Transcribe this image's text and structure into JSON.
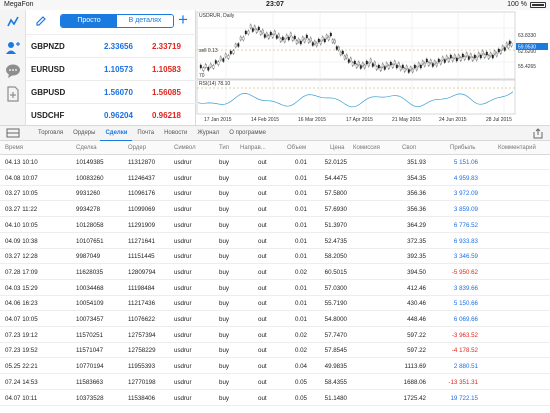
{
  "status_bar": {
    "carrier": "MegaFon",
    "time": "23:07",
    "battery": "100 %"
  },
  "quotes_panel": {
    "segments": [
      "Просто",
      "В деталях"
    ],
    "active_segment": "Просто",
    "rows": [
      {
        "symbol": "GBPNZD",
        "bid": "2.33656",
        "ask": "2.33719"
      },
      {
        "symbol": "EURUSD",
        "bid": "1.10573",
        "ask": "1.10583"
      },
      {
        "symbol": "GBPUSD",
        "bid": "1.56070",
        "ask": "1.56085"
      },
      {
        "symbol": "USDCHF",
        "bid": "0.96204",
        "ask": "0.96218"
      }
    ]
  },
  "chart": {
    "title": "USDRUR, Daily",
    "sell_label": "sell 0.13",
    "indicator_label": "RSI(14) 78.10",
    "level_label": "70",
    "price_labels": [
      "63.8330",
      "62.6200",
      "59.9530",
      "55.4265"
    ],
    "current_price": "59.9530",
    "x_labels": [
      "17 Jan 2015",
      "14 Feb 2015",
      "16 Mar 2015",
      "17 Apr 2015",
      "21 May 2015",
      "24 Jun 2015",
      "28 Jul 2015"
    ],
    "accent": "#1a7ae0"
  },
  "tabs": {
    "items": [
      "Торговля",
      "Ордеры",
      "Сделки",
      "Почта",
      "Новости",
      "Журнал",
      "О программе"
    ],
    "active": "Сделки"
  },
  "table": {
    "columns": [
      "Время",
      "Сделка",
      "Ордер",
      "Символ",
      "Тип",
      "Направ...",
      "Объем",
      "Цена",
      "Комиссия",
      "Своп",
      "Прибыль",
      "Комментарий"
    ],
    "rows": [
      [
        "04.13 10:10",
        "10149385",
        "11312870",
        "usdrur",
        "buy",
        "out",
        "0.01",
        "52.0125",
        "",
        "351.93",
        "5 151.06"
      ],
      [
        "04.08 10:07",
        "10083260",
        "11246437",
        "usdrur",
        "buy",
        "out",
        "0.01",
        "54.4475",
        "",
        "354.35",
        "4 959.83"
      ],
      [
        "03.27 10:05",
        "9931260",
        "11096176",
        "usdrur",
        "buy",
        "out",
        "0.01",
        "57.5800",
        "",
        "356.36",
        "3 972.09"
      ],
      [
        "03.27 11:22",
        "9934278",
        "11099069",
        "usdrur",
        "buy",
        "out",
        "0.01",
        "57.6930",
        "",
        "356.36",
        "3 859.09"
      ],
      [
        "04.10 10:05",
        "10128058",
        "11291909",
        "usdrur",
        "buy",
        "out",
        "0.01",
        "51.3970",
        "",
        "364.29",
        "6 776.52"
      ],
      [
        "04.09 10:38",
        "10107651",
        "11271641",
        "usdrur",
        "buy",
        "out",
        "0.01",
        "52.4735",
        "",
        "372.35",
        "6 933.83"
      ],
      [
        "03.27 12:28",
        "9987049",
        "11151445",
        "usdrur",
        "buy",
        "out",
        "0.01",
        "58.2050",
        "",
        "392.35",
        "3 346.59"
      ],
      [
        "07.28 17:09",
        "11628035",
        "12809794",
        "usdrur",
        "buy",
        "out",
        "0.02",
        "60.5015",
        "",
        "394.50",
        "-5 950.62"
      ],
      [
        "04.03 15:29",
        "10034468",
        "11198484",
        "usdrur",
        "buy",
        "out",
        "0.01",
        "57.0300",
        "",
        "412.46",
        "3 839.66"
      ],
      [
        "04.06 16:23",
        "10054109",
        "11217436",
        "usdrur",
        "buy",
        "out",
        "0.01",
        "55.7190",
        "",
        "430.46",
        "5 150.66"
      ],
      [
        "04.07 10:05",
        "10073457",
        "11076622",
        "usdrur",
        "buy",
        "out",
        "0.01",
        "54.8000",
        "",
        "448.46",
        "6 069.66"
      ],
      [
        "07.23 19:12",
        "11570251",
        "12757394",
        "usdrur",
        "buy",
        "out",
        "0.02",
        "57.7470",
        "",
        "597.22",
        "-3 963.52"
      ],
      [
        "07.23 19:52",
        "11571047",
        "12758229",
        "usdrur",
        "buy",
        "out",
        "0.02",
        "57.8545",
        "",
        "597.22",
        "-4 178.52"
      ],
      [
        "05.25 22:21",
        "10770194",
        "11955393",
        "usdrur",
        "buy",
        "out",
        "0.04",
        "49.9835",
        "",
        "1113.69",
        "2 880.51"
      ],
      [
        "07.24 14:53",
        "11583663",
        "12770198",
        "usdrur",
        "buy",
        "out",
        "0.05",
        "58.4355",
        "",
        "1688.06",
        "-13 351.31"
      ],
      [
        "04.07 10:11",
        "10373528",
        "11538406",
        "usdrur",
        "buy",
        "out",
        "0.05",
        "51.1480",
        "",
        "1725.42",
        "19 722.15"
      ]
    ]
  }
}
